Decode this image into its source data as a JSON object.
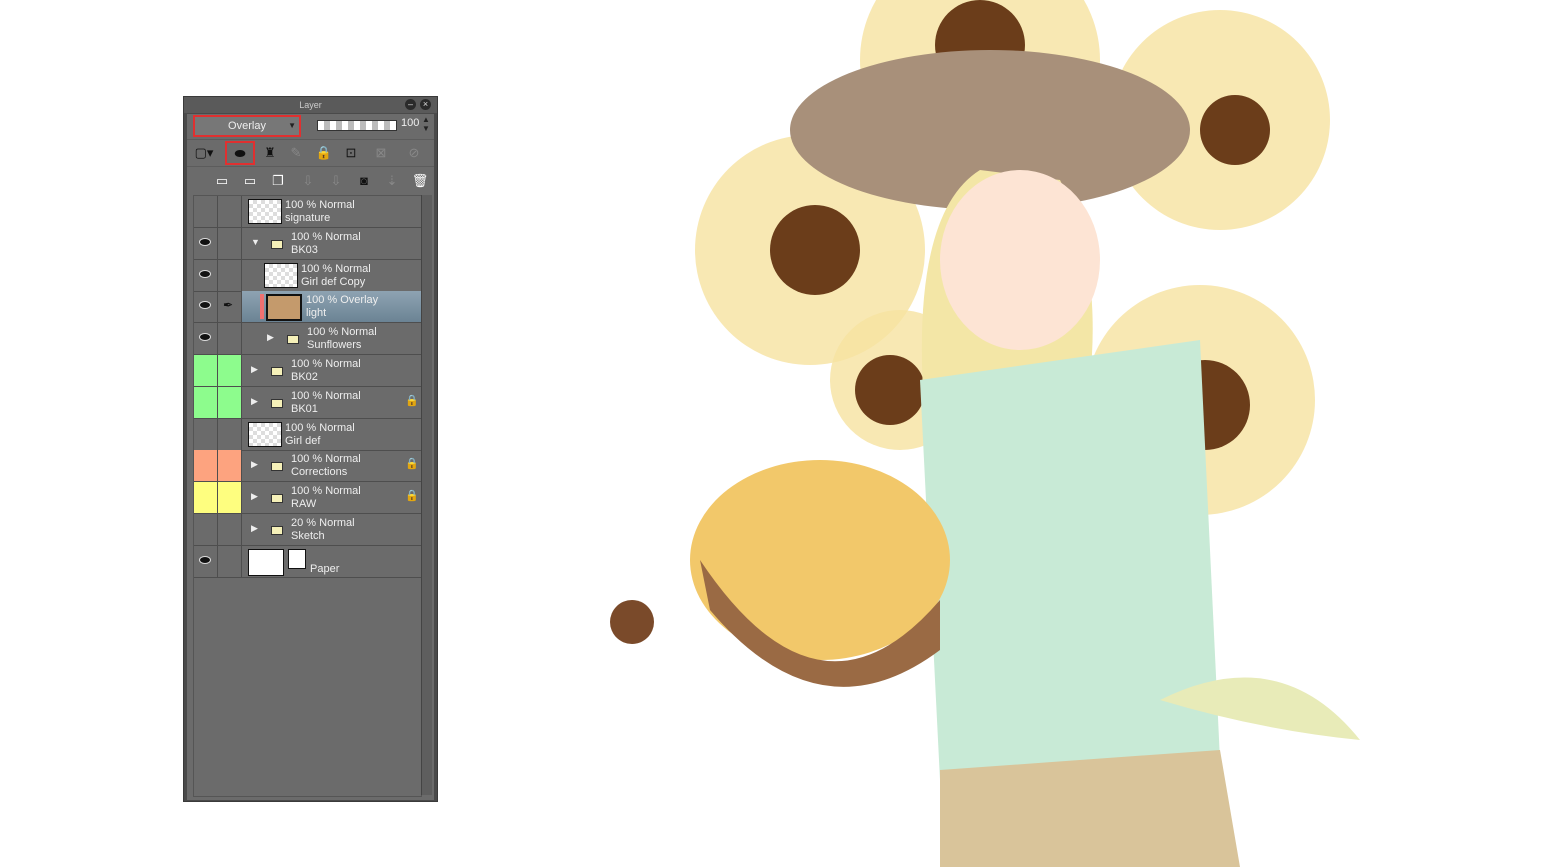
{
  "panel": {
    "title": "Layer",
    "blend_mode": "Overlay",
    "opacity": "100"
  },
  "layers": [
    {
      "opacity": "100 % Normal",
      "name": "signature",
      "visible": false,
      "kind": "raster",
      "indent": 0
    },
    {
      "opacity": "100 % Normal",
      "name": "BK03",
      "visible": true,
      "kind": "folder-open",
      "indent": 0
    },
    {
      "opacity": "100 % Normal",
      "name": "Girl def Copy",
      "visible": true,
      "kind": "raster",
      "indent": 1
    },
    {
      "opacity": "100 % Overlay",
      "name": "light",
      "visible": true,
      "kind": "fill",
      "indent": 1,
      "selected": true
    },
    {
      "opacity": "100 % Normal",
      "name": "Sunflowers",
      "visible": true,
      "kind": "folder",
      "indent": 1
    },
    {
      "opacity": "100 % Normal",
      "name": "BK02",
      "visible": false,
      "kind": "folder",
      "indent": 0,
      "color": "#8dfc8d"
    },
    {
      "opacity": "100 % Normal",
      "name": "BK01",
      "visible": false,
      "kind": "folder",
      "indent": 0,
      "color": "#8dfc8d",
      "locked": true
    },
    {
      "opacity": "100 % Normal",
      "name": "Girl def",
      "visible": false,
      "kind": "raster",
      "indent": 0
    },
    {
      "opacity": "100 % Normal",
      "name": "Corrections",
      "visible": false,
      "kind": "folder",
      "indent": 0,
      "color": "#fda37f",
      "locked": true
    },
    {
      "opacity": "100 % Normal",
      "name": "RAW",
      "visible": false,
      "kind": "folder",
      "indent": 0,
      "color": "#fefe7f",
      "locked": true
    },
    {
      "opacity": "20 % Normal",
      "name": "Sketch",
      "visible": false,
      "kind": "folder",
      "indent": 0
    },
    {
      "opacity": "",
      "name": "Paper",
      "visible": true,
      "kind": "paper",
      "indent": 0
    }
  ],
  "colors": {
    "highlight": "#e03030",
    "fill": "#c49a6c"
  }
}
